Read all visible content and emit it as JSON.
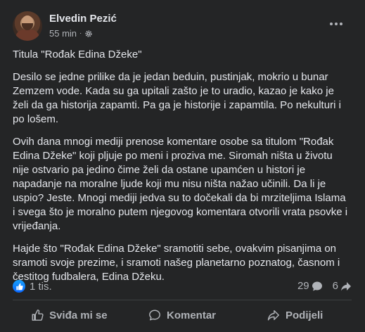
{
  "post": {
    "author": "Elvedin Pezić",
    "time": "55 min",
    "separator": "·",
    "paragraphs": [
      "Titula \"Rođak Edina Džeke\"",
      "Desilo se jedne prilike da je jedan beduin, pustinjak, mokrio u bunar Zemzem vode. Kada su ga upitali zašto je to uradio, kazao je kako je želi da ga historija zapamti. Pa ga je historije i zapamtila. Po nekulturi i po lošem.",
      "Ovih dana mnogi mediji prenose komentare osobe sa titulom \"Rođak Edina Džeke\" koji pljuje po meni  i proziva me.  Siromah  ništa u životu nije ostvario pa jedino čime želi da ostane upamćen u histori je napadanje na moralne ljude koji mu nisu ništa nažao učinili. Da li je uspio? Jeste. Mnogi mediji jedva su to dočekali da bi mrziteljima Islama i svega što je moralno putem njegovog komentara otvorili vrata psovke i vrijeđanja.",
      "Hajde što \"Rođak Edina Džeke\" sramotiti sebe, ovakvim pisanjima on sramoti svoje prezime,  i sramoti našeg planetarno poznatog, časnom i čestitog fudbalera, Edina Džeku."
    ]
  },
  "stats": {
    "likes": "1 tis.",
    "comments": "29",
    "shares": "6"
  },
  "actions": {
    "like": "Sviđa mi se",
    "comment": "Komentar",
    "share": "Podijeli"
  },
  "colors": {
    "background": "#242526",
    "text": "#e4e6eb",
    "secondary": "#b0b3b8",
    "like_blue": "#0866ff"
  },
  "icons": [
    "more-options-icon",
    "gear-icon",
    "like-badge-icon",
    "comment-icon",
    "share-icon",
    "thumbs-up-icon"
  ]
}
